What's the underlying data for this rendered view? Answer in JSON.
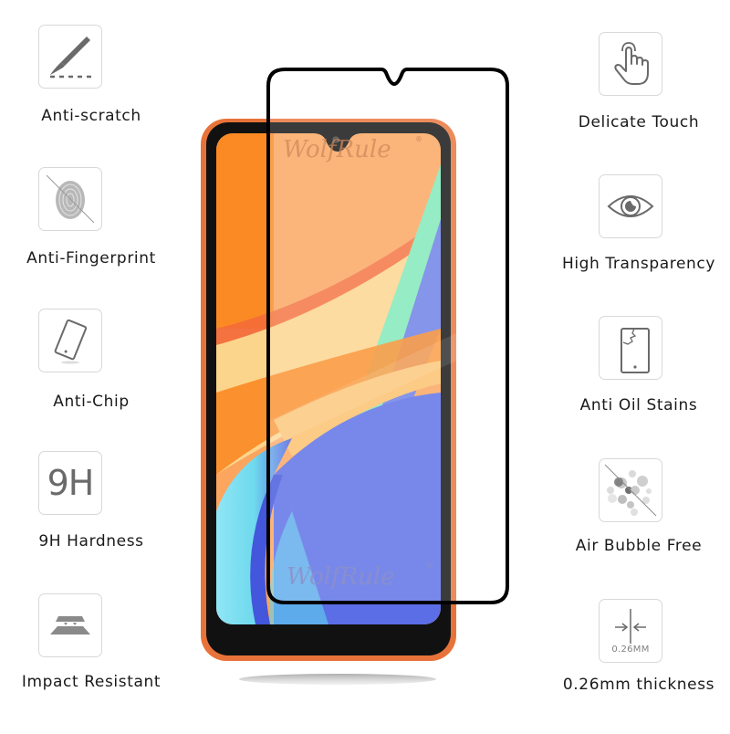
{
  "brand": {
    "watermark": "WolfRule",
    "registered_mark": "®"
  },
  "colors": {
    "phone_body": "#e8733a",
    "bezel": "#111111",
    "protector_edge": "#000000",
    "icon_gray": "#6a6a6a",
    "icon_border": "#d8d8d8",
    "label_text": "#1a1a1a"
  },
  "features_left": [
    {
      "label": "Anti-scratch",
      "icon": "scalpel-icon"
    },
    {
      "label": "Anti-Fingerprint",
      "icon": "fingerprint-crossed-icon"
    },
    {
      "label": "Anti-Chip",
      "icon": "tilted-phone-icon"
    },
    {
      "label": "9H Hardness",
      "icon": "9h-icon",
      "icon_text": "9H"
    },
    {
      "label": "Impact Resistant",
      "icon": "impact-layers-icon"
    }
  ],
  "features_right": [
    {
      "label": "Delicate Touch",
      "icon": "touch-hand-icon"
    },
    {
      "label": "High Transparency",
      "icon": "eye-icon"
    },
    {
      "label": "Anti Oil Stains",
      "icon": "cracked-phone-icon"
    },
    {
      "label": "Air Bubble Free",
      "icon": "bubbles-crossed-icon"
    },
    {
      "label": "0.26mm thickness",
      "icon": "thickness-icon",
      "icon_text": "0.26MM"
    }
  ]
}
